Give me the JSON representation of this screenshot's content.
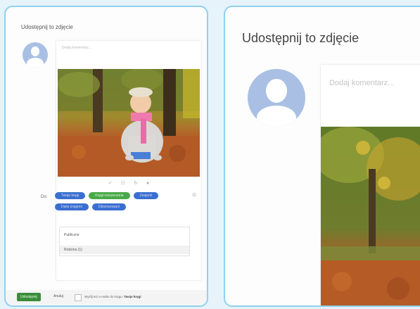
{
  "left_dialog": {
    "title": "Udostępnij to zdjęcie",
    "comment_placeholder": "Dodaj komentarz...",
    "photo_toolbar": [
      "✓",
      "☷",
      "↻",
      "●"
    ],
    "share_label": "Do:",
    "chips": [
      {
        "label": "Twoje kręgi",
        "color": "#3a6fd1"
      },
      {
        "label": "Kręgi rozszerzone",
        "color": "#49a84a"
      },
      {
        "label": "Znajomi",
        "color": "#3a6fd1"
      },
      {
        "label": "Dalsi znajomi",
        "color": "#3a6fd1"
      },
      {
        "label": "Obserwowani",
        "color": "#3a6fd1"
      }
    ],
    "dropdown_items": [
      "Publiczne",
      "Rodzina (1)"
    ],
    "share_button": "Udostępnij",
    "cancel_button": "Anuluj",
    "notify_text": "Wyślij też e-maile do kręgu:",
    "notify_circle": "Twoje kręgi"
  },
  "right_dialog": {
    "title": "Udostępnij to zdjęcie",
    "comment_placeholder": "Dodaj komentarz..."
  }
}
